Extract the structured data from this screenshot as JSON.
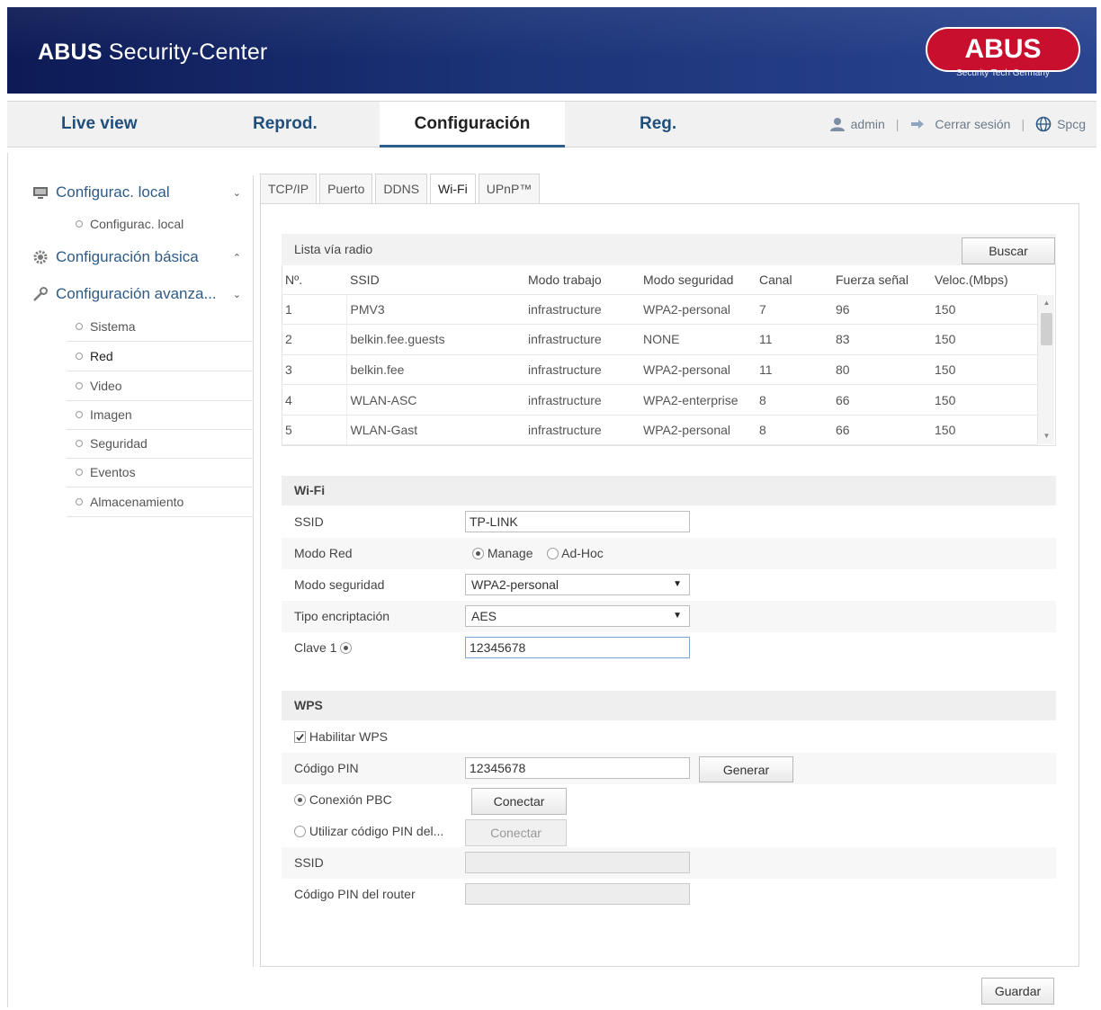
{
  "header": {
    "title_bold": "ABUS",
    "title_rest": " Security-Center",
    "logo_text": "ABUS",
    "logo_subtitle": "Security Tech Germany"
  },
  "nav": {
    "tabs": [
      "Live view",
      "Reprod.",
      "Configuración",
      "Reg."
    ],
    "user": "admin",
    "logout": "Cerrar sesión",
    "language": "Spcg"
  },
  "sidebar": {
    "local_title": "Configurac. local",
    "local_item": "Configurac. local",
    "basic_title": "Configuración básica",
    "advanced_title": "Configuración avanza...",
    "advanced_items": [
      "Sistema",
      "Red",
      "Video",
      "Imagen",
      "Seguridad",
      "Eventos",
      "Almacenamiento"
    ]
  },
  "subtabs": [
    "TCP/IP",
    "Puerto",
    "DDNS",
    "Wi-Fi",
    "UPnP™"
  ],
  "wireless_list": {
    "title": "Lista vía radio",
    "search_button": "Buscar",
    "columns": [
      "Nº.",
      "SSID",
      "Modo trabajo",
      "Modo seguridad",
      "Canal",
      "Fuerza señal",
      "Veloc.(Mbps)"
    ],
    "rows": [
      [
        "1",
        "PMV3",
        "infrastructure",
        "WPA2-personal",
        "7",
        "96",
        "150"
      ],
      [
        "2",
        "belkin.fee.guests",
        "infrastructure",
        "NONE",
        "11",
        "83",
        "150"
      ],
      [
        "3",
        "belkin.fee",
        "infrastructure",
        "WPA2-personal",
        "11",
        "80",
        "150"
      ],
      [
        "4",
        "WLAN-ASC",
        "infrastructure",
        "WPA2-enterprise",
        "8",
        "66",
        "150"
      ],
      [
        "5",
        "WLAN-Gast",
        "infrastructure",
        "WPA2-personal",
        "8",
        "66",
        "150"
      ]
    ]
  },
  "wifi": {
    "section_title": "Wi-Fi",
    "ssid_label": "SSID",
    "ssid_value": "TP-LINK",
    "mode_label": "Modo Red",
    "mode_manage": "Manage",
    "mode_adhoc": "Ad-Hoc",
    "security_label": "Modo seguridad",
    "security_value": "WPA2-personal",
    "encryption_label": "Tipo encriptación",
    "encryption_value": "AES",
    "key_label": "Clave 1",
    "key_value": "12345678"
  },
  "wps": {
    "section_title": "WPS",
    "enable_label": "Habilitar WPS",
    "pin_label": "Código PIN",
    "pin_value": "12345678",
    "generate_button": "Generar",
    "pbc_label": "Conexión PBC",
    "connect_button": "Conectar",
    "use_pin_label": "Utilizar código PIN del...",
    "connect_button_2": "Conectar",
    "ssid_label": "SSID",
    "ssid_value": "",
    "router_pin_label": "Código PIN del router",
    "router_pin_value": ""
  },
  "save_button": "Guardar",
  "colors": {
    "header_dark": "#0d1a55",
    "header_light": "#2a4590",
    "logo_red": "#c8102e",
    "link_blue": "#2d5a86"
  }
}
